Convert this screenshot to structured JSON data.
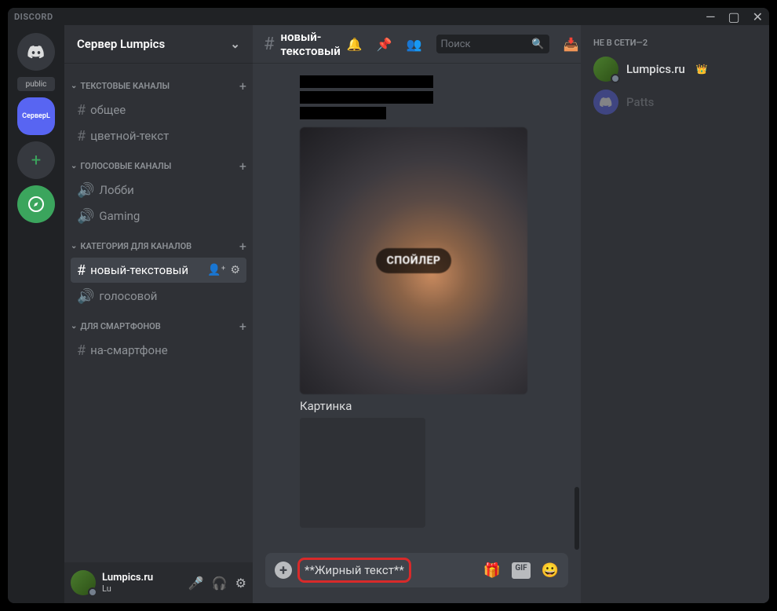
{
  "titlebar": {
    "brand": "DISCORD"
  },
  "servers": {
    "public_tag": "public",
    "active_label": "СерверL"
  },
  "server_header": {
    "name": "Сервер Lumpics"
  },
  "categories": {
    "text": {
      "label": "ТЕКСТОВЫЕ КАНАЛЫ",
      "channels": [
        "общее",
        "цветной-текст"
      ]
    },
    "voice": {
      "label": "ГОЛОСОВЫЕ КАНАЛЫ",
      "channels": [
        "Лобби",
        "Gaming"
      ]
    },
    "cat3": {
      "label": "КАТЕГОРИЯ ДЛЯ КАНАЛОВ",
      "text_channel": "новый-текстовый",
      "voice_channel": "голосовой"
    },
    "phones": {
      "label": "ДЛЯ СМАРТФОНОВ",
      "channel": "на-смартфоне"
    }
  },
  "user_panel": {
    "name": "Lumpics.ru",
    "tag": "Lu"
  },
  "chat": {
    "channel_title": "новый-текстовый",
    "search_placeholder": "Поиск",
    "spoiler_badge": "СПОЙЛЕР",
    "caption": "Картинка",
    "composer_text": "**Жирный текст**",
    "gif_label": "GIF"
  },
  "members": {
    "offline_label": "НЕ В СЕТИ—2",
    "list": [
      {
        "name": "Lumpics.ru",
        "owner": true
      },
      {
        "name": "Patts",
        "owner": false
      }
    ]
  }
}
